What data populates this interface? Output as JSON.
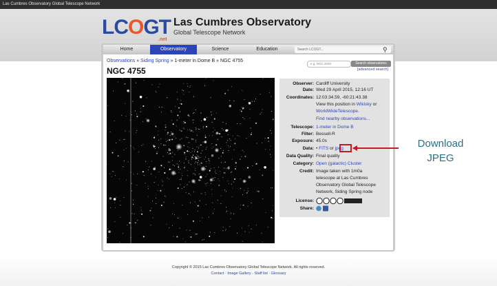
{
  "window": {
    "title": "Las Cumbres Observatory Global Telescope Network"
  },
  "header": {
    "logo_main": "LCOGT",
    "logo_suffix": ".net",
    "site_title": "Las Cumbres Observatory",
    "site_subtitle": "Global Telescope Network"
  },
  "nav": {
    "items": [
      {
        "label": "Home"
      },
      {
        "label": "Observatory"
      },
      {
        "label": "Science"
      },
      {
        "label": "Education"
      }
    ],
    "active": "Observatory",
    "search_placeholder": "Search LCOGT..."
  },
  "breadcrumb": {
    "link1": "Observations",
    "sep1": " » ",
    "link2": "Siding Spring",
    "rest": " » 1-meter in Dome B » NGC 4755"
  },
  "page_title": "NGC 4755",
  "obs_search": {
    "placeholder": "e.g. NGC 2020",
    "button": "Search observations",
    "advanced": "[advanced search]"
  },
  "details": {
    "observer_label": "Observer:",
    "observer": "Cardiff University",
    "date_label": "Date:",
    "date": "Wed 29 April 2015, 12:16 UT",
    "coords_label": "Coordinates:",
    "coords": "12:03:34.59, -60:21:43.38",
    "view_pre": "View this position in ",
    "view_link1": "Wikisky",
    "view_or": " or",
    "view_link2": "WorldWideTelescope.",
    "nearby": "Find nearby observations...",
    "telescope_label": "Telescope:",
    "telescope": "1-meter in Dome B",
    "filter_label": "Filter:",
    "filter": "Bessell-R",
    "exposure_label": "Exposure:",
    "exposure": "45.0s",
    "data_label": "Data:",
    "data_bullet": "•",
    "data_fits": "FITS",
    "data_or": " or ",
    "data_jpeg": "jpeg",
    "quality_label": "Data Quality:",
    "quality": "Final quality",
    "category_label": "Category:",
    "category": "Open (galactic) Cluster",
    "credit_label": "Credit:",
    "credit_lines": [
      "Image taken with 1m0a",
      "telescope at Las Cumbres",
      "Observatory Global Telescope",
      "Network, Siding Spring node"
    ],
    "license_label": "License:",
    "share_label": "Share:"
  },
  "annotation": {
    "line1": "Download",
    "line2": "JPEG"
  },
  "footer": {
    "copyright": "Copyright © 2015 Las Cumbres Observatory Global Telescope Network. All rights reserved.",
    "links": "Contact · Image Gallery · Staff list · Glossary"
  },
  "colors": {
    "accent": "#2b45b8",
    "annotation": "#2b6f87",
    "highlight": "#c21b24",
    "logo_blue": "#2c4aa0",
    "logo_orange": "#e8582a"
  }
}
